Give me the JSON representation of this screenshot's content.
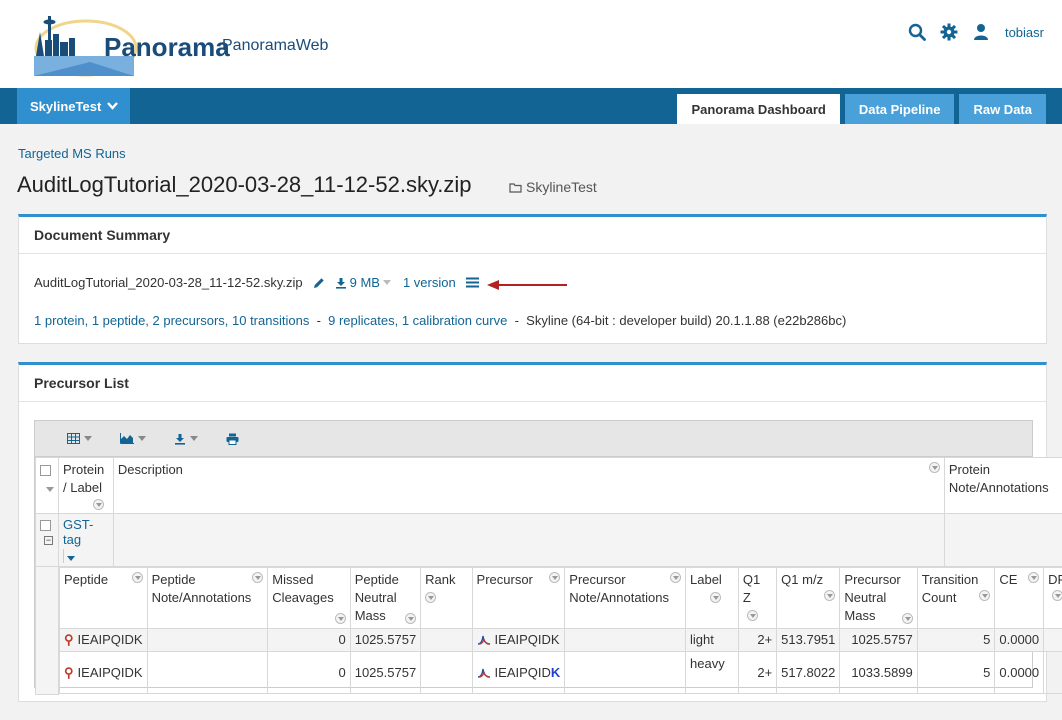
{
  "header": {
    "brand": "Panorama",
    "brand_sub": "PanoramaWeb",
    "user": "tobiasr",
    "icons": [
      "search-icon",
      "gear-icon",
      "user-icon"
    ]
  },
  "nav": {
    "project": "SkylineTest",
    "tabs": [
      "Panorama Dashboard",
      "Data Pipeline",
      "Raw Data"
    ],
    "active_tab": "Panorama Dashboard"
  },
  "breadcrumb": "Targeted MS Runs",
  "page_title": "AuditLogTutorial_2020-03-28_11-12-52.sky.zip",
  "folder": "SkylineTest",
  "summary": {
    "title": "Document Summary",
    "file_name": "AuditLogTutorial_2020-03-28_11-12-52.sky.zip",
    "size": "9 MB",
    "versions": "1 version",
    "counts_link": "1 protein, 1 peptide, 2 precursors, 10 transitions",
    "sep1": "-",
    "replicates_link": "9 replicates, 1 calibration curve",
    "sep2": "-",
    "software": "Skyline (64-bit : developer build) 20.1.1.88 (e22b286bc)"
  },
  "precursor_list": {
    "title": "Precursor List",
    "outer_headers": {
      "protein": "Protein / Label",
      "description": "Description",
      "protein_note": "Protein Note/Annotations"
    },
    "protein_group": "GST-tag",
    "inner_headers": [
      "Peptide",
      "Peptide Note/Annotations",
      "Missed Cleavages",
      "Peptide Neutral Mass",
      "Rank",
      "Precursor",
      "Precursor Note/Annotations",
      "Label",
      "Q1 Z",
      "Q1 m/z",
      "Precursor Neutral Mass",
      "Transition Count",
      "CE",
      "DP"
    ],
    "rows": [
      {
        "peptide": "IEAIPQIDK",
        "peptide_note": "",
        "missed": "0",
        "neutral_mass": "1025.5757",
        "rank": "",
        "precursor": "IEAIPQIDK",
        "precursor_heavy_suffix": "",
        "precursor_note": "",
        "label": "light",
        "z": "2+",
        "mz": "513.7951",
        "prec_mass": "1025.5757",
        "transitions": "5",
        "ce": "0.0000",
        "dp": ""
      },
      {
        "peptide": "IEAIPQIDK",
        "peptide_note": "",
        "missed": "0",
        "neutral_mass": "1025.5757",
        "rank": "",
        "precursor": "IEAIPQID",
        "precursor_heavy_suffix": "K",
        "precursor_note": "",
        "label": "heavy",
        "z": "2+",
        "mz": "517.8022",
        "prec_mass": "1033.5899",
        "transitions": "5",
        "ce": "0.0000",
        "dp": ""
      }
    ]
  }
}
